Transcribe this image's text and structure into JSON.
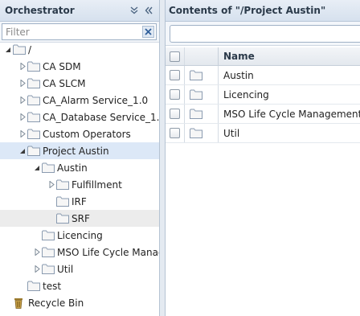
{
  "left_panel": {
    "title": "Orchestrator",
    "filter_placeholder": "Filter"
  },
  "tree": [
    {
      "label": "/",
      "expanded": true
    },
    {
      "label": "CA SDM"
    },
    {
      "label": "CA SLCM"
    },
    {
      "label": "CA_Alarm Service_1.0"
    },
    {
      "label": "CA_Database Service_1."
    },
    {
      "label": "Custom Operators"
    },
    {
      "label": "Project Austin",
      "expanded": true,
      "selected": true
    },
    {
      "label": "Austin",
      "expanded": true
    },
    {
      "label": "Fulfillment"
    },
    {
      "label": "IRF"
    },
    {
      "label": "SRF",
      "hovered": true
    },
    {
      "label": "Licencing"
    },
    {
      "label": "MSO Life Cycle Manag"
    },
    {
      "label": "Util"
    },
    {
      "label": "test"
    },
    {
      "label": "Recycle Bin"
    }
  ],
  "right_panel": {
    "title": "Contents of \"/Project Austin\"",
    "search_value": "",
    "columns": {
      "name": "Name"
    },
    "rows": [
      {
        "name": "Austin"
      },
      {
        "name": "Licencing"
      },
      {
        "name": "MSO Life Cycle Management"
      },
      {
        "name": "Util"
      }
    ]
  },
  "colors": {
    "selection": "#dce8f7",
    "header_gradient_top": "#e8eef6",
    "header_gradient_bottom": "#d6e1ee",
    "folder_fill": "#f6f6f6",
    "folder_stroke": "#8a9bb0"
  },
  "icons": {
    "collapse_panel": "double-chevron-down-icon",
    "pin_panel": "double-chevron-left-icon",
    "clear_filter": "close-icon",
    "folder": "folder-icon",
    "recycle_bin": "trash-icon"
  }
}
